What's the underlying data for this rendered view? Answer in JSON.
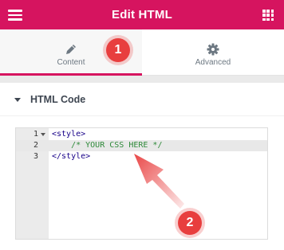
{
  "header": {
    "title": "Edit HTML",
    "menu_icon": "hamburger-menu-icon",
    "apps_icon": "grid-apps-icon"
  },
  "tabs": [
    {
      "label": "Content",
      "icon": "pencil-icon",
      "active": true
    },
    {
      "label": "Advanced",
      "icon": "gear-icon",
      "active": false
    }
  ],
  "section": {
    "title": "HTML Code",
    "expanded": true
  },
  "editor": {
    "lines": [
      {
        "number": "1",
        "text": "<style>",
        "kind": "tag",
        "foldable": true
      },
      {
        "number": "2",
        "text": "    /* YOUR CSS HERE */",
        "kind": "comment",
        "active": true
      },
      {
        "number": "3",
        "text": "</style>",
        "kind": "tag"
      }
    ]
  },
  "annotations": {
    "badge_1": "1",
    "badge_2": "2"
  },
  "colors": {
    "brand": "#d6145f",
    "badge": "#e83e3e",
    "code_tag": "#170088",
    "code_comment": "#2f8a3a"
  }
}
